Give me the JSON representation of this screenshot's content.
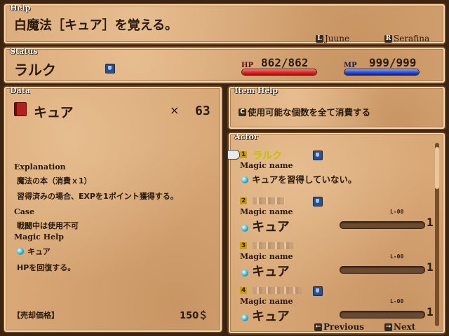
{
  "help": {
    "title": "Help",
    "message": "白魔法［キュア］を覚える。",
    "btn_l": "L",
    "prev_actor": "Juune",
    "btn_r": "R",
    "next_actor": "Serafina"
  },
  "status": {
    "title": "Status",
    "name": "ラルク",
    "hp_label": "HP",
    "hp_value": "862/862",
    "hp_fraction": 1.0,
    "mp_label": "MP",
    "mp_value": "999/999",
    "mp_fraction": 1.0
  },
  "data": {
    "title": "Data",
    "item_name": "キュア",
    "times": "×",
    "quantity": "63",
    "explanation_label": "Explanation",
    "explanation_line1": "魔法の本（消費ｘ1）",
    "explanation_line2": "習得済みの場合、EXPを1ポイント獲得する。",
    "case_label": "Case",
    "case_text": "戦闘中は使用不可",
    "magic_help_label": "Magic Help",
    "magic_help_name": "キュア",
    "magic_help_desc": "HPを回復する。",
    "sell_label": "【売却価格】",
    "sell_price": "150＄"
  },
  "item_help": {
    "title": "Item Help",
    "btn": "C",
    "text": "使用可能な個数を全て消費する"
  },
  "actor": {
    "title": "Actor",
    "rows": [
      {
        "index": "1",
        "name": "ラルク",
        "magic_name_label": "Magic name",
        "status_text": "キュアを習得していない。"
      },
      {
        "index": "2",
        "name": "",
        "magic_name_label": "Magic name",
        "spell": "キュア",
        "level_label": "L-00",
        "level": "1",
        "exp_fraction": 0
      },
      {
        "index": "3",
        "name": "",
        "magic_name_label": "Magic name",
        "spell": "キュア",
        "level_label": "L-00",
        "level": "1",
        "exp_fraction": 0
      },
      {
        "index": "4",
        "name": "",
        "magic_name_label": "Magic name",
        "spell": "キュア",
        "level_label": "L-00",
        "level": "1",
        "exp_fraction": 0
      }
    ],
    "prev_btn": "←",
    "prev_label": "Previous",
    "next_btn": "→",
    "next_label": "Next"
  },
  "colors": {
    "hp": "#e8292b",
    "mp": "#2f55e0",
    "actor_name": "#c9c000"
  }
}
